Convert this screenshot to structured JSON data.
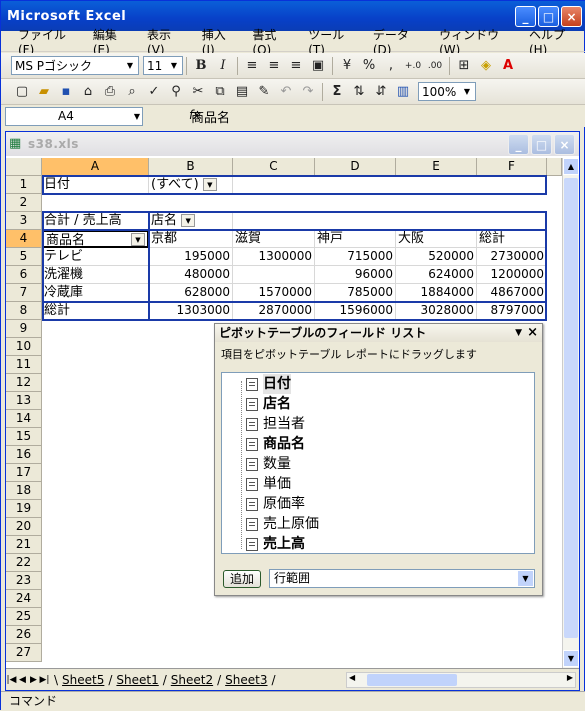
{
  "app": {
    "title": "Microsoft Excel"
  },
  "menu": [
    "ファイル(F)",
    "編集(E)",
    "表示(V)",
    "挿入(I)",
    "書式(O)",
    "ツール(T)",
    "データ(D)",
    "ウィンドウ(W)",
    "ヘルプ(H)"
  ],
  "format_toolbar": {
    "font_name": "MS Pゴシック",
    "font_size": "11",
    "bold": "B",
    "italic": "I",
    "percent": "%",
    "comma": ","
  },
  "standard_toolbar": {
    "sigma": "Σ",
    "zoom": "100%"
  },
  "formula_bar": {
    "cell_ref": "A4",
    "fx": "fx",
    "content": "商品名"
  },
  "workbook": {
    "title": "s38.xls"
  },
  "grid": {
    "columns": [
      "A",
      "B",
      "C",
      "D",
      "E",
      "F"
    ],
    "rows": [
      "1",
      "2",
      "3",
      "4",
      "5",
      "6",
      "7",
      "8",
      "9",
      "10",
      "11",
      "12",
      "13",
      "14",
      "15",
      "16",
      "17",
      "18",
      "19",
      "20",
      "21",
      "22",
      "23",
      "24",
      "25",
      "26",
      "27"
    ],
    "r1": {
      "a": "日付",
      "b": "(すべて)"
    },
    "r3": {
      "a": "合計 / 売上高",
      "b": "店名"
    },
    "r4": {
      "a": "商品名",
      "b": "京都",
      "c": "滋賀",
      "d": "神戸",
      "e": "大阪",
      "f": "総計"
    },
    "r5": {
      "a": "テレビ",
      "b": "195000",
      "c": "1300000",
      "d": "715000",
      "e": "520000",
      "f": "2730000"
    },
    "r6": {
      "a": "洗濯機",
      "b": "480000",
      "c": "",
      "d": "96000",
      "e": "624000",
      "f": "1200000"
    },
    "r7": {
      "a": "冷蔵庫",
      "b": "628000",
      "c": "1570000",
      "d": "785000",
      "e": "1884000",
      "f": "4867000"
    },
    "r8": {
      "a": "総計",
      "b": "1303000",
      "c": "2870000",
      "d": "1596000",
      "e": "3028000",
      "f": "8797000"
    }
  },
  "sheets": [
    "Sheet5",
    "Sheet1",
    "Sheet2",
    "Sheet3"
  ],
  "pivot": {
    "title": "ピボットテーブルのフィールド リスト",
    "hint": "項目をピボットテーブル レポートにドラッグします",
    "fields": [
      "日付",
      "店名",
      "担当者",
      "商品名",
      "数量",
      "単価",
      "原価率",
      "売上原価",
      "売上高"
    ],
    "add_label": "追加",
    "area": "行範囲"
  },
  "status": {
    "text": "コマンド"
  }
}
